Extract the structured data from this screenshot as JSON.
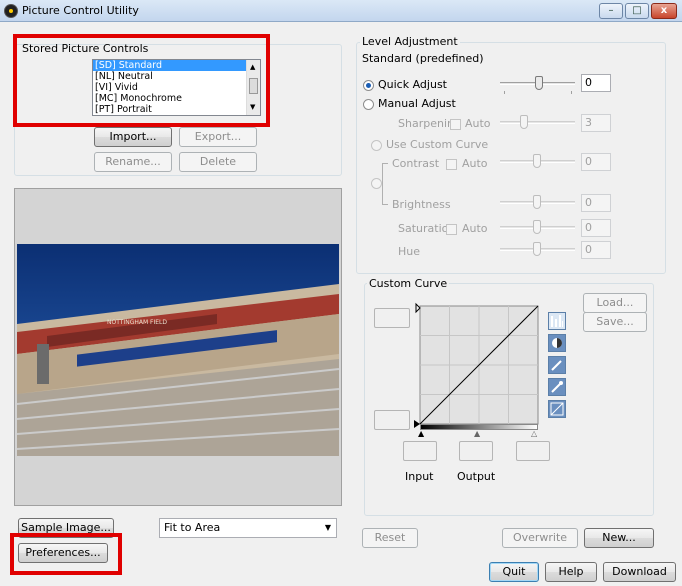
{
  "window": {
    "title": "Picture Control Utility",
    "minimize_glyph": "–",
    "maximize_glyph": "□",
    "close_glyph": "x"
  },
  "stored": {
    "label": "Stored Picture Controls",
    "items": [
      {
        "label": "[SD] Standard",
        "selected": true
      },
      {
        "label": "[NL] Neutral",
        "selected": false
      },
      {
        "label": "[VI] Vivid",
        "selected": false
      },
      {
        "label": "[MC] Monochrome",
        "selected": false
      },
      {
        "label": "[PT] Portrait",
        "selected": false
      }
    ],
    "import_label": "Import...",
    "export_label": "Export...",
    "rename_label": "Rename...",
    "delete_label": "Delete"
  },
  "preview": {
    "sample_label": "Sample Image...",
    "fit_value": "Fit to Area",
    "preferences_label": "Preferences...",
    "scoreboard_text": "NOTTINGHAM FIELD"
  },
  "level": {
    "group_label": "Level Adjustment",
    "preset_name": "Standard (predefined)",
    "quick_adjust_label": "Quick Adjust",
    "quick_adjust_value": "0",
    "manual_adjust_label": "Manual Adjust",
    "sharpening_label": "Sharpening",
    "sharpening_value": "3",
    "auto_label": "Auto",
    "use_curve_label": "Use Custom Curve",
    "contrast_label": "Contrast",
    "contrast_value": "0",
    "brightness_label": "Brightness",
    "brightness_value": "0",
    "saturation_label": "Saturation",
    "saturation_value": "0",
    "hue_label": "Hue",
    "hue_value": "0"
  },
  "curve": {
    "group_label": "Custom Curve",
    "load_label": "Load...",
    "save_label": "Save...",
    "input_label": "Input",
    "output_label": "Output"
  },
  "bottom": {
    "reset_label": "Reset",
    "overwrite_label": "Overwrite",
    "new_label": "New...",
    "quit_label": "Quit",
    "help_label": "Help",
    "download_label": "Download"
  },
  "colors": {
    "highlight_red": "#e00000",
    "selection_blue": "#3399ff",
    "sky_blue": "#1f4f9a"
  }
}
